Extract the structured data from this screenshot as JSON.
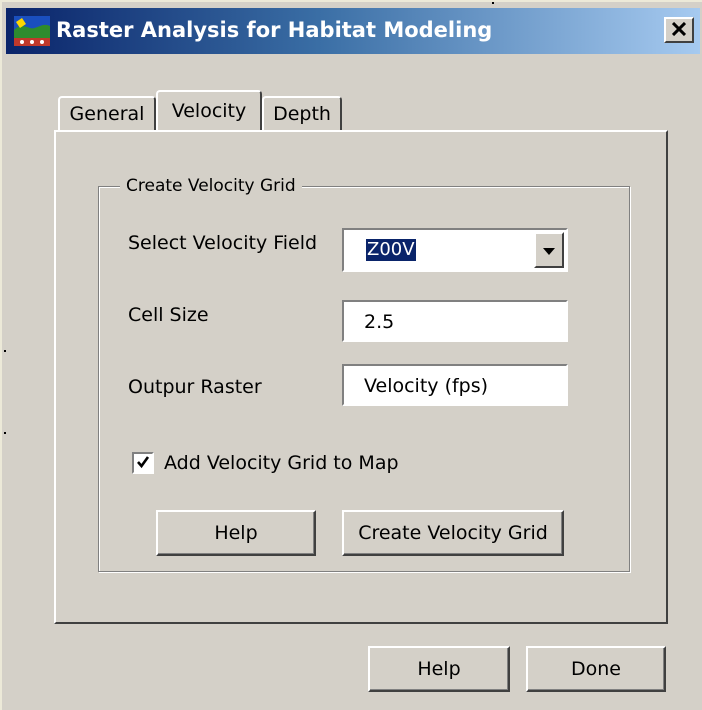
{
  "window": {
    "title": "Raster Analysis for Habitat Modeling"
  },
  "tabs": [
    {
      "label": "General",
      "active": false
    },
    {
      "label": "Velocity",
      "active": true
    },
    {
      "label": "Depth",
      "active": false
    }
  ],
  "group": {
    "title": "Create Velocity Grid",
    "velocity_field_label": "Select Velocity Field",
    "velocity_field_value": "Z00V",
    "cell_size_label": "Cell Size",
    "cell_size_value": "2.5",
    "output_raster_label": "Outpur Raster",
    "output_raster_value": "Velocity (fps)",
    "add_to_map_label": "Add Velocity Grid to Map",
    "add_to_map_checked": true,
    "help_button": "Help",
    "create_button": "Create Velocity Grid"
  },
  "footer": {
    "help_button": "Help",
    "done_button": "Done"
  },
  "icons": {
    "app": "habitat-app-icon",
    "close": "close-icon",
    "dropdown": "chevron-down-icon",
    "check": "checkmark-icon"
  },
  "colors": {
    "title_gradient_start": "#0a246a",
    "title_gradient_end": "#a6caf0",
    "face": "#d4d0c8"
  }
}
